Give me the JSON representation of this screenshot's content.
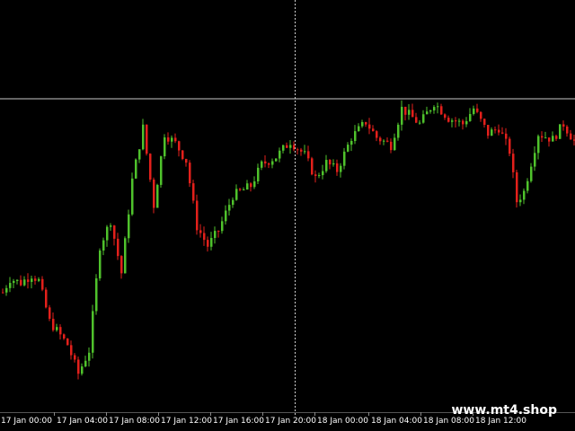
{
  "watermark": "www.mt4.shop",
  "colors": {
    "background": "#000000",
    "bull": "#4fc22c",
    "bear": "#e3201b",
    "axis_text": "#ffffff",
    "hline": "#c8c8c8",
    "vline": "#d0d0d0"
  },
  "chart_data": {
    "type": "candlestick",
    "title": "",
    "xlabel": "",
    "ylabel": "",
    "grid": false,
    "x_tick_labels": [
      "17 Jan 00:00",
      "17 Jan 04:00",
      "17 Jan 08:00",
      "17 Jan 12:00",
      "17 Jan 16:00",
      "17 Jan 20:00",
      "18 Jan 00:00",
      "18 Jan 04:00",
      "18 Jan 08:00",
      "18 Jan 12:00"
    ],
    "price_path": [
      [
        0,
        0.6
      ],
      [
        2,
        0.67
      ],
      [
        5,
        0.65
      ],
      [
        8,
        0.69
      ],
      [
        10,
        0.66
      ],
      [
        13,
        0.45
      ],
      [
        18,
        0.33
      ],
      [
        21,
        0.18
      ],
      [
        24,
        0.3
      ],
      [
        27,
        0.84
      ],
      [
        30,
        0.97
      ],
      [
        33,
        0.7
      ],
      [
        36,
        1.18
      ],
      [
        39,
        1.45
      ],
      [
        42,
        1.05
      ],
      [
        45,
        1.42
      ],
      [
        48,
        1.37
      ],
      [
        51,
        1.28
      ],
      [
        54,
        0.94
      ],
      [
        57,
        0.84
      ],
      [
        60,
        0.92
      ],
      [
        64,
        1.1
      ],
      [
        69,
        1.15
      ],
      [
        72,
        1.26
      ],
      [
        76,
        1.3
      ],
      [
        80,
        1.38
      ],
      [
        84,
        1.31
      ],
      [
        87,
        1.19
      ],
      [
        90,
        1.27
      ],
      [
        93,
        1.23
      ],
      [
        97,
        1.4
      ],
      [
        101,
        1.48
      ],
      [
        104,
        1.4
      ],
      [
        108,
        1.36
      ],
      [
        111,
        1.55
      ],
      [
        116,
        1.47
      ],
      [
        120,
        1.58
      ],
      [
        124,
        1.5
      ],
      [
        128,
        1.47
      ],
      [
        131,
        1.55
      ],
      [
        135,
        1.42
      ],
      [
        138,
        1.45
      ],
      [
        141,
        1.33
      ],
      [
        143,
        1.07
      ],
      [
        145,
        1.12
      ],
      [
        149,
        1.42
      ],
      [
        153,
        1.39
      ],
      [
        156,
        1.47
      ],
      [
        159,
        1.38
      ]
    ],
    "price_range": [
      0,
      1.6
    ],
    "crosshair": {
      "horizontal_at": 1.6,
      "vertical_at_bar": 82
    }
  }
}
